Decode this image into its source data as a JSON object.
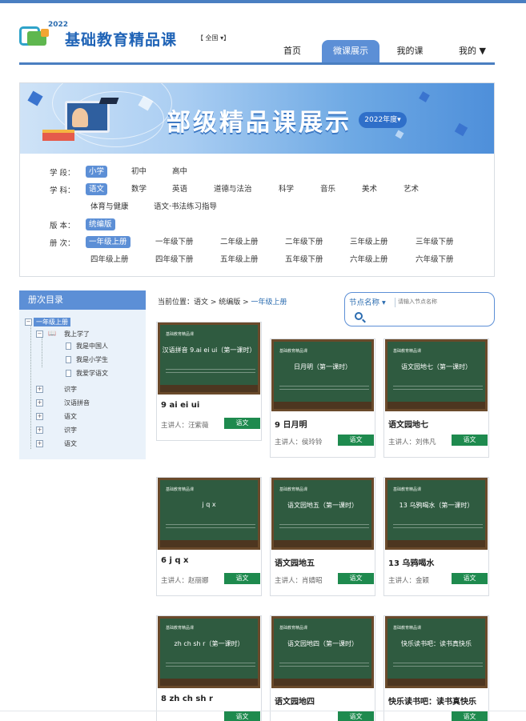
{
  "header": {
    "logo_year": "2022",
    "brand": "基础教育精品课",
    "scope": "【 全国 ▾】",
    "nav": [
      "首页",
      "微课展示",
      "我的课",
      "我的 ▼"
    ],
    "active_nav": "微课展示"
  },
  "banner": {
    "title": "部级精品课展示",
    "year": "2022年度▾"
  },
  "filters": {
    "stage_label": "学 段：",
    "stages": [
      "小学",
      "初中",
      "高中"
    ],
    "subject_label": "学 科：",
    "subjects": [
      "语文",
      "数学",
      "英语",
      "道德与法治",
      "科学",
      "音乐",
      "美术",
      "艺术",
      "体育与健康",
      "语文·书法练习指导"
    ],
    "edition_label": "版 本：",
    "edition": "统编版",
    "volume_label": "册 次：",
    "volumes": [
      "一年级上册",
      "一年级下册",
      "二年级上册",
      "二年级下册",
      "三年级上册",
      "三年级下册",
      "四年级上册",
      "四年级下册",
      "五年级上册",
      "五年级下册",
      "六年级上册",
      "六年级下册"
    ]
  },
  "sidebar": {
    "title": "册次目录",
    "root": "一年级上册",
    "group": "我上学了",
    "leaves": [
      "我是中国人",
      "我是小学生",
      "我爱学语文"
    ],
    "nodes": [
      "识字",
      "汉语拼音",
      "语文",
      "识字",
      "语文"
    ]
  },
  "breadcrumb": {
    "prefix": "当前位置：",
    "path": "语文 > 统编版 > ",
    "current": "一年级上册"
  },
  "search": {
    "dropdown": "节点名称",
    "placeholder": "请输入节点名称"
  },
  "board_publisher": "基础教育精品课",
  "subject_tag": "语文",
  "cards": [
    {
      "board": "汉语拼音 9.ai ei ui（第一课时）",
      "title": "9 ai ei ui",
      "host": "主讲人：汪紫薇"
    },
    {
      "board": "日月明（第一课时）",
      "title": "9 日月明",
      "host": "主讲人：侯玲铃"
    },
    {
      "board": "语文园地七（第一课时）",
      "title": "语文园地七",
      "host": "主讲人：刘伟凡"
    },
    {
      "board": "j q x",
      "title": "6 j q x",
      "host": "主讲人：赵丽娜"
    },
    {
      "board": "语文园地五（第一课时）",
      "title": "语文园地五",
      "host": "主讲人：肖婧昭"
    },
    {
      "board": "13 乌鸦喝水（第一课时）",
      "title": "13 乌鸦喝水",
      "host": "主讲人：金颖"
    },
    {
      "board": "zh ch sh r（第一课时）",
      "title": "8 zh ch sh r",
      "host": ""
    },
    {
      "board": "语文园地四（第一课时）",
      "title": "语文园地四",
      "host": ""
    },
    {
      "board": "快乐读书吧：读书真快乐",
      "title": "快乐读书吧：读书真快乐",
      "host": ""
    }
  ]
}
